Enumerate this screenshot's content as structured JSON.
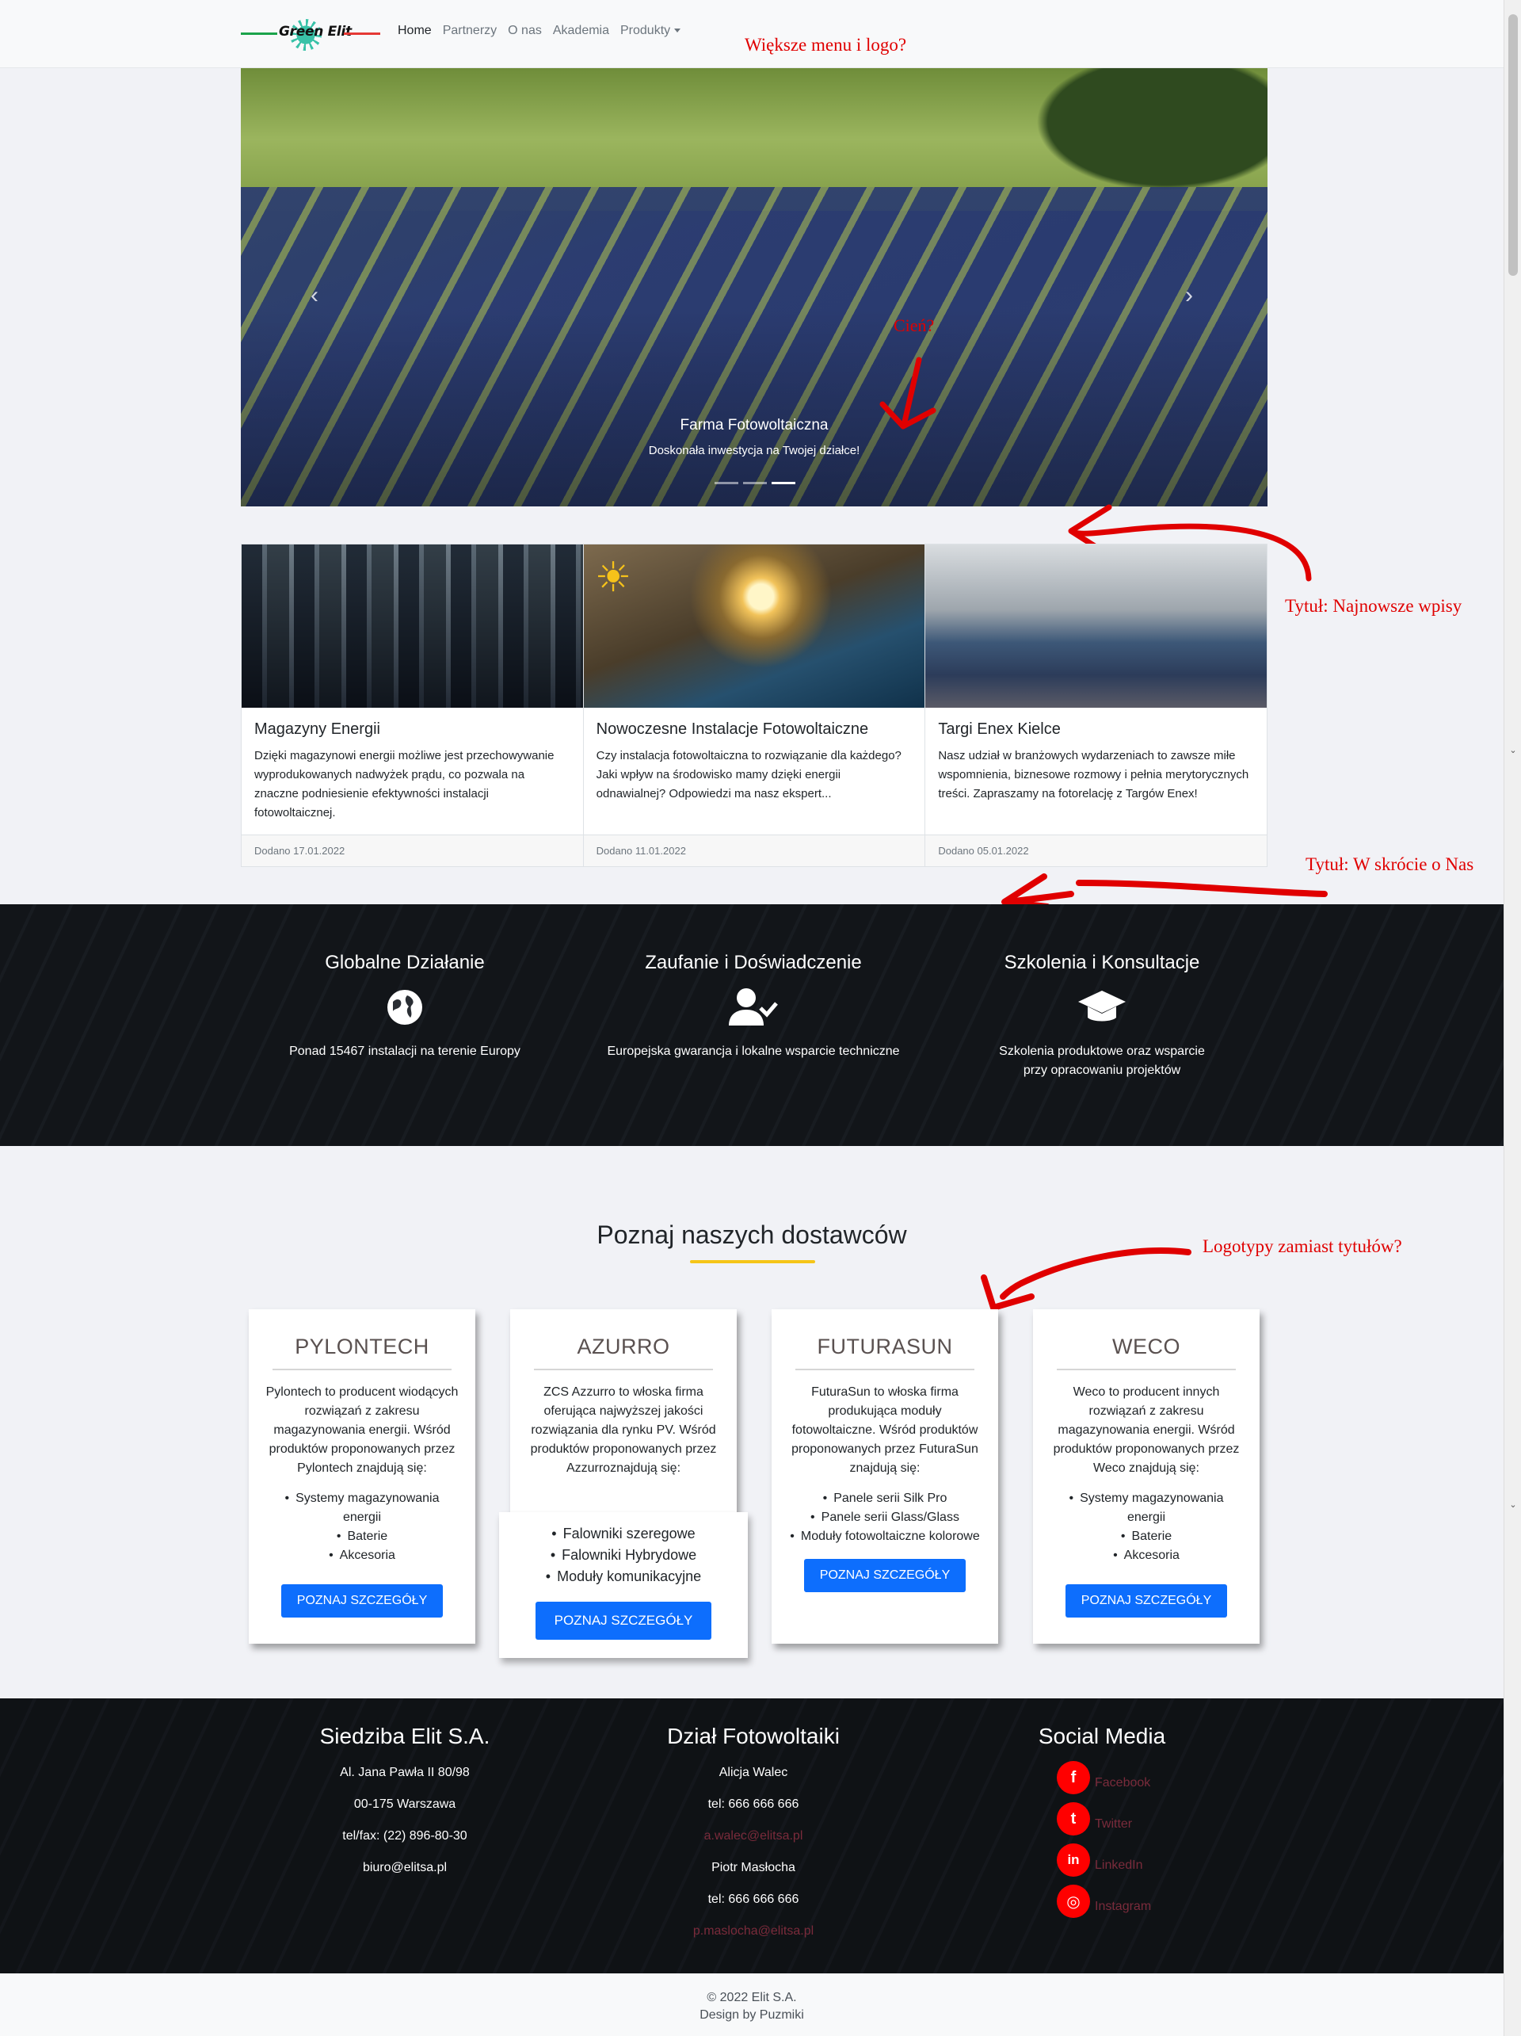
{
  "nav": {
    "logo_text": "Green Elit",
    "items": [
      "Home",
      "Partnerzy",
      "O nas",
      "Akademia",
      "Produkty"
    ]
  },
  "annotations": {
    "menu": "Większe menu i logo?",
    "shadow": "Cień?",
    "latest": "Tytuł: Najnowsze wpisy",
    "about": "Tytuł: W skrócie o Nas",
    "logos": "Logotypy zamiast tytułów?"
  },
  "hero": {
    "title": "Farma Fotowoltaiczna",
    "subtitle": "Doskonała inwestycja na Twojej działce!",
    "active_slide": 3,
    "slides": 3
  },
  "posts": [
    {
      "title": "Magazyny Energii",
      "text": "Dzięki magazynowi energii możliwe jest przechowywanie wyprodukowanych nadwyżek prądu, co pozwala na znaczne podniesienie efektywności instalacji fotowoltaicznej.",
      "date": "Dodano 17.01.2022"
    },
    {
      "title": "Nowoczesne Instalacje Fotowoltaiczne",
      "text": "Czy instalacja fotowoltaiczna to rozwiązanie dla każdego? Jaki wpływ na środowisko mamy dzięki energii odnawialnej? Odpowiedzi ma nasz ekspert...",
      "date": "Dodano 11.01.2022"
    },
    {
      "title": "Targi Enex Kielce",
      "text": "Nasz udział w branżowych wydarzeniach to zawsze miłe wspomnienia, biznesowe rozmowy i pełnia merytorycznych treści. Zapraszamy na fotorelację z Targów Enex!",
      "date": "Dodano 05.01.2022"
    }
  ],
  "features": [
    {
      "title": "Globalne Działanie",
      "icon": "globe-icon",
      "text": "Ponad 15467 instalacji na terenie Europy"
    },
    {
      "title": "Zaufanie i Doświadczenie",
      "icon": "user-check-icon",
      "text": "Europejska gwarancja i lokalne wsparcie techniczne"
    },
    {
      "title": "Szkolenia i Konsultacje",
      "icon": "graduation-cap-icon",
      "text": "Szkolenia produktowe oraz wsparcie przy opracowaniu projektów"
    }
  ],
  "suppliers": {
    "title": "Poznaj naszych dostawców",
    "button_label": "POZNAJ SZCZEGÓŁY",
    "items": [
      {
        "name": "PYLONTECH",
        "text": "Pylontech to producent wiodących rozwiązań z zakresu magazynowania energii. Wśród produktów proponowanych przez Pylontech znajdują się:",
        "list": [
          "Systemy magazynowania energii",
          "Baterie",
          "Akcesoria"
        ]
      },
      {
        "name": "AZURRO",
        "text": "ZCS Azzurro to włoska firma oferująca najwyższej jakości rozwiązania dla rynku PV. Wśród produktów proponowanych przez Azzurroznajdują się:",
        "list": [
          "Falowniki szeregowe",
          "Falowniki Hybrydowe",
          "Moduły komunikacyjne"
        ]
      },
      {
        "name": "FUTURASUN",
        "text": "FuturaSun to włoska firma produkująca moduły fotowoltaiczne. Wśród produktów proponowanych przez FuturaSun znajdują się:",
        "list": [
          "Panele serii Silk Pro",
          "Panele serii Glass/Glass",
          "Moduły fotowoltaiczne kolorowe"
        ]
      },
      {
        "name": "WECO",
        "text": "Weco to producent innych rozwiązań z zakresu magazynowania energii. Wśród produktów proponowanych przez Weco znajdują się:",
        "list": [
          "Systemy magazynowania energii",
          "Baterie",
          "Akcesoria"
        ]
      }
    ]
  },
  "footer": {
    "hq": {
      "title": "Siedziba Elit S.A.",
      "lines": [
        "Al. Jana Pawła II 80/98",
        "00-175 Warszawa",
        "tel/fax: (22) 896-80-30",
        "biuro@elitsa.pl"
      ]
    },
    "pv": {
      "title": "Dział Fotowoltaiki",
      "lines": [
        "Alicja Walec",
        "tel: 666 666 666",
        "a.walec@elitsa.pl",
        "Piotr Masłocha",
        "tel: 666 666 666",
        "p.maslocha@elitsa.pl"
      ]
    },
    "social": {
      "title": "Social Media",
      "items": [
        {
          "label": "Facebook",
          "icon": "facebook-icon",
          "glyph": "f"
        },
        {
          "label": "Twitter",
          "icon": "twitter-icon",
          "glyph": "t"
        },
        {
          "label": "LinkedIn",
          "icon": "linkedin-icon",
          "glyph": "in"
        },
        {
          "label": "Instagram",
          "icon": "instagram-icon",
          "glyph": "◎"
        }
      ]
    }
  },
  "copyright": {
    "line1": "© 2022 Elit S.A.",
    "line2": "Design by Puzmiki"
  },
  "colors": {
    "accent": "#0d6efd",
    "annotation": "#e00000",
    "underline": "#f5c518",
    "social": "#ff0000"
  }
}
